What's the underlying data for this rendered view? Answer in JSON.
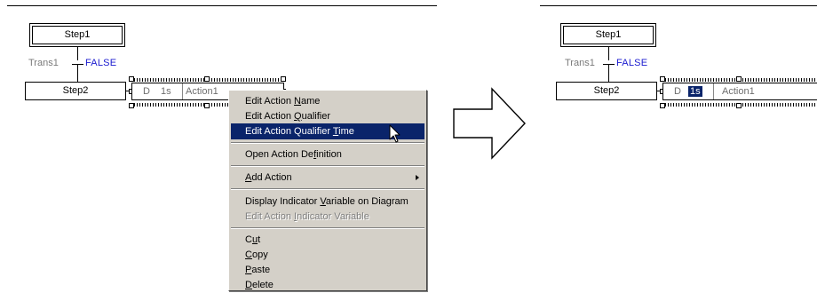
{
  "before": {
    "step1": "Step1",
    "transition_name": "Trans1",
    "transition_condition": "FALSE",
    "step2": "Step2",
    "action": {
      "qualifier": "D",
      "time": "1s",
      "name": "Action1"
    }
  },
  "context_menu": {
    "items": [
      {
        "label": "Edit Action Name",
        "mnemonic": "N"
      },
      {
        "label": "Edit Action Qualifier",
        "mnemonic": "Q"
      },
      {
        "label": "Edit Action Qualifier Time",
        "mnemonic": "T",
        "highlighted": true
      },
      {
        "label": "Open Action Definition",
        "mnemonic": "f"
      },
      {
        "label": "Add Action",
        "mnemonic": "A",
        "submenu": true
      },
      {
        "label": "Display Indicator Variable on Diagram",
        "mnemonic": "V"
      },
      {
        "label": "Edit Action Indicator Variable",
        "mnemonic": "I",
        "disabled": true
      },
      {
        "label": "Cut",
        "mnemonic": "u"
      },
      {
        "label": "Copy",
        "mnemonic": "C"
      },
      {
        "label": "Paste",
        "mnemonic": "P"
      },
      {
        "label": "Delete",
        "mnemonic": "D"
      }
    ]
  },
  "after": {
    "step1": "Step1",
    "transition_name": "Trans1",
    "transition_condition": "FALSE",
    "step2": "Step2",
    "action": {
      "qualifier": "D",
      "time_selected": "1s",
      "name": "Action1"
    }
  },
  "icons": {
    "arrow": "right-arrow-icon",
    "cursor": "mouse-pointer-icon"
  }
}
